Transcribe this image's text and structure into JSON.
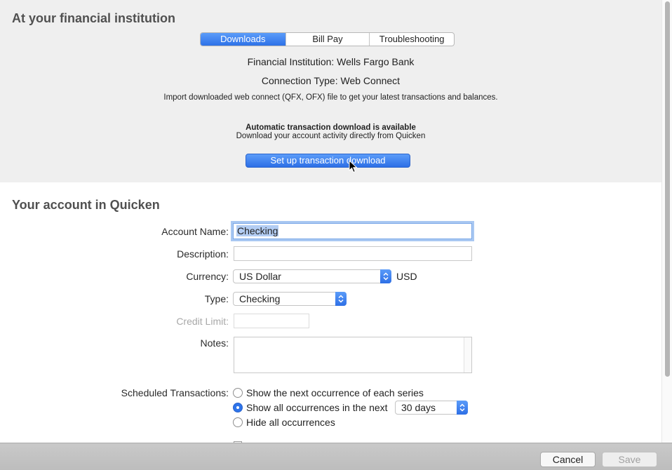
{
  "institution": {
    "heading": "At your financial institution",
    "tabs": [
      "Downloads",
      "Bill Pay",
      "Troubleshooting"
    ],
    "active_tab": "Downloads",
    "fi_line": "Financial Institution: Wells Fargo Bank",
    "connection_line": "Connection Type: Web Connect",
    "import_note": "Import downloaded web connect (QFX, OFX) file to get your latest transactions and balances.",
    "auto_title": "Automatic transaction download is available",
    "auto_desc": "Download your account activity directly from Quicken",
    "setup_button": "Set up transaction download"
  },
  "account": {
    "heading": "Your account in Quicken",
    "name_label": "Account Name:",
    "name_value": "Checking",
    "description_label": "Description:",
    "description_value": "",
    "currency_label": "Currency:",
    "currency_value": "US Dollar",
    "currency_code": "USD",
    "type_label": "Type:",
    "type_value": "Checking",
    "credit_limit_label": "Credit Limit:",
    "credit_limit_value": "",
    "notes_label": "Notes:",
    "notes_value": "",
    "scheduled_label": "Scheduled Transactions:",
    "scheduled_options": [
      {
        "label": "Show the next occurrence of each series",
        "selected": false
      },
      {
        "label": "Show all occurrences in the next",
        "selected": true
      },
      {
        "label": "Hide all occurrences",
        "selected": false
      }
    ],
    "period_value": "30 days"
  },
  "footer": {
    "cancel": "Cancel",
    "save": "Save"
  },
  "colors": {
    "accent": "#2d71e8",
    "section_bg": "#efefef",
    "heading": "#505050"
  }
}
